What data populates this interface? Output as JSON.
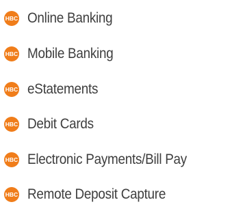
{
  "colors": {
    "accent": "#f07d1a",
    "label_text": "#3e3e3e",
    "icon_text": "#ffffff"
  },
  "services": {
    "icon_name": "hbc-logo-icon",
    "icon_text": "HBC",
    "items": [
      {
        "label": "Online Banking"
      },
      {
        "label": "Mobile Banking"
      },
      {
        "label": "eStatements"
      },
      {
        "label": "Debit Cards"
      },
      {
        "label": "Electronic Payments/Bill Pay"
      },
      {
        "label": "Remote Deposit Capture"
      }
    ]
  }
}
